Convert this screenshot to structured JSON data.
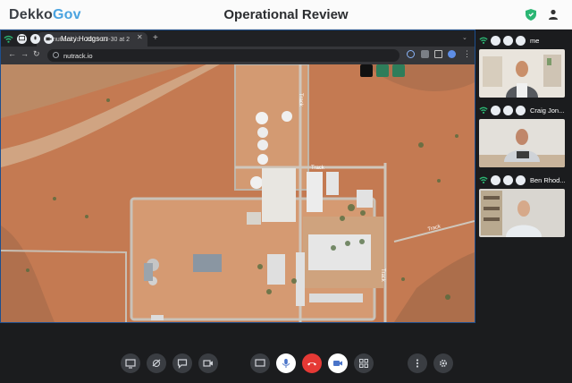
{
  "app": {
    "logo_main": "Dekko",
    "logo_accent": "Gov",
    "title": "Operational Review"
  },
  "share": {
    "presenter": "Mary Hodgson",
    "tab_title": "nutrack.io - 2023-03-30 at 2",
    "url": "nutrack.io",
    "map_labels": [
      "Track",
      "Track",
      "Track",
      "Track"
    ]
  },
  "participants": [
    {
      "name": "me"
    },
    {
      "name": "Craig Jon..."
    },
    {
      "name": "Ben Rhod..."
    }
  ],
  "colors": {
    "accent": "#4aa3e0",
    "danger": "#e53935",
    "signal": "#2bb673"
  },
  "icons": {
    "top_right": [
      "shield-icon",
      "user-icon"
    ],
    "controls": [
      "screen-share-icon",
      "wireless-icon",
      "chat-icon",
      "record-icon",
      "monitor-icon",
      "microphone-icon",
      "hangup-icon",
      "camera-icon",
      "grid-icon",
      "more-icon",
      "settings-icon"
    ]
  }
}
